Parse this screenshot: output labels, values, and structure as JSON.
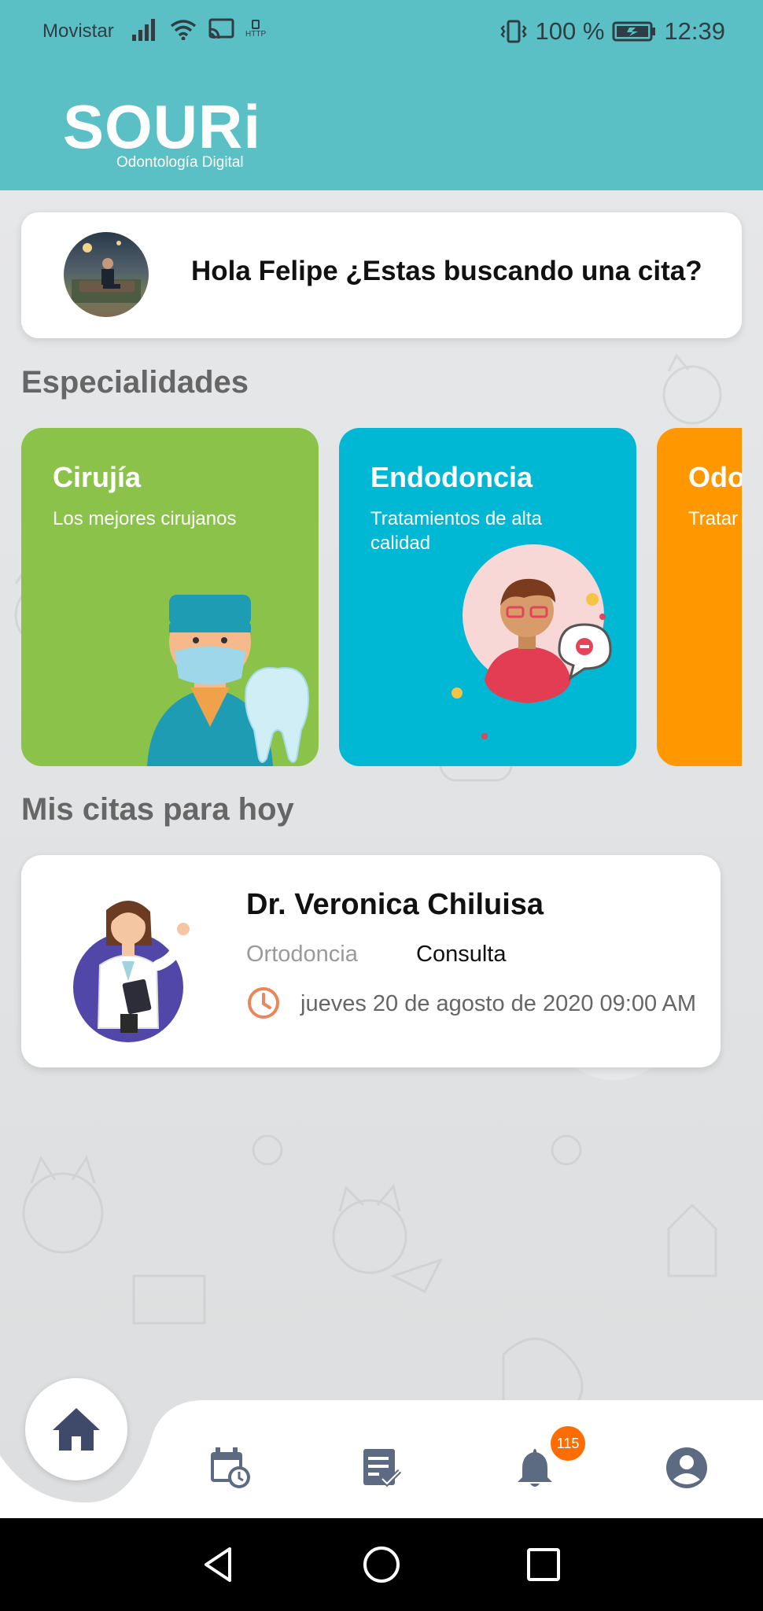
{
  "status_bar": {
    "carrier": "Movistar",
    "http_label": "HTTP",
    "battery": "100 %",
    "time": "12:39"
  },
  "logo": {
    "wordmark": "SOURi",
    "subtitle": "Odontología Digital"
  },
  "greeting": {
    "text": "Hola Felipe ¿Estas buscando una cita?"
  },
  "specialties": {
    "title": "Especialidades",
    "items": [
      {
        "title": "Cirujía",
        "description": "Los mejores cirujanos",
        "color": "#8bc34a"
      },
      {
        "title": "Endodoncia",
        "description": "Tratamientos de alta calidad",
        "color": "#00b8d4"
      },
      {
        "title": "Odo",
        "description": "Tratar",
        "color": "#ff9800"
      }
    ]
  },
  "appointments": {
    "title": "Mis citas para hoy",
    "items": [
      {
        "doctor": "Dr. Veronica Chiluisa",
        "specialty": "Ortodoncia",
        "type": "Consulta",
        "datetime": "jueves 20 de agosto de 2020 09:00 AM"
      }
    ]
  },
  "bottom_nav": {
    "items": [
      "home-icon",
      "calendar-clock-icon",
      "checklist-icon",
      "bell-icon",
      "account-icon"
    ],
    "notification_count": "115",
    "accent": "#3f4a6b"
  },
  "colors": {
    "header": "#5bc0c6",
    "badge": "#ff6d00",
    "clock": "#e9875a"
  }
}
